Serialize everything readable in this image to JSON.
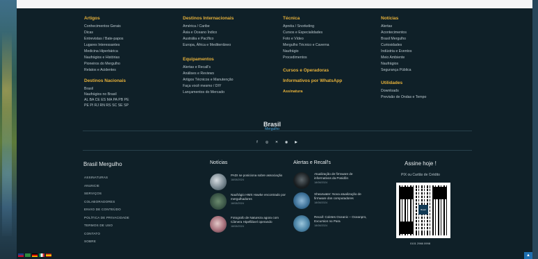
{
  "columns": {
    "artigos": {
      "title": "Artigos",
      "items": [
        "Conhecimentos Gerais",
        "Dicas",
        "Entrevistas / Bate-papos",
        "Lugares Interessantes",
        "Medicina Hiperbárica",
        "Naufrágios e Histórias",
        "Pioneiros do Mergulho",
        "Relatos e Acidentes"
      ]
    },
    "destinos_nacionais": {
      "title": "Destinos Nacionais",
      "items": [
        "Brasil",
        "Naufrágios no Brasil",
        "AL  BA  CE  ES  MA  PA  PB  PE",
        "PE  PI  RJ  RN  RS  SC  SE  SP"
      ]
    },
    "destinos_internacionais": {
      "title": "Destinos Internacionais",
      "items": [
        "América / Caribe",
        "Ásia e Oceano Índico",
        "Austrália e Pacífico",
        "Europa, África e Mediterrâneo"
      ]
    },
    "equipamentos": {
      "title": "Equipamentos",
      "items": [
        "Alertas e Recall's",
        "Análises e Reviews",
        "Artigos Técnicos e Manutenção",
        "Faça você mesmo / DIY",
        "Lançamentos do Mercado"
      ]
    },
    "tecnica": {
      "title": "Técnica",
      "items": [
        "Apnéia / Snorkeling",
        "Cursos e Especialidades",
        "Foto e Vídeo",
        "Mergulho Técnico e Caverna",
        "Naufrágio",
        "Procedimentos"
      ]
    },
    "cursos": {
      "title": "Cursos e Operadoras"
    },
    "whatsapp": {
      "title": "Informativos por WhatsApp"
    },
    "assinatura": {
      "title": "Assinatura"
    },
    "noticias": {
      "title": "Notícias",
      "items": [
        "Alertas",
        "Acontecimentos",
        "Brasil Mergulho",
        "Curiosidades",
        "Indústria e Eventos",
        "Meio Ambiente",
        "Naufrágios",
        "Segurança Pública"
      ]
    },
    "utilidades": {
      "title": "Utilidades",
      "items": [
        "Downloads",
        "Previsão de Ondas e Tempo"
      ]
    }
  },
  "brand": {
    "name": "Brasil",
    "sub": "Mergulho"
  },
  "social_icons": [
    "facebook-icon",
    "instagram-icon",
    "x-icon",
    "whatsapp-icon",
    "youtube-icon"
  ],
  "bottom": {
    "brand_title": "Brasil Mergulho",
    "menu": [
      "ASSINATURAS",
      "ANUNCIE",
      "SERVIÇOS",
      "COLABORADORES",
      "ENVIO DE CONTEÚDO",
      "POLÍTICA DE PRIVACIDADE",
      "TERMOS DE USO",
      "CONTATO",
      "SOBRE"
    ],
    "news_title": "Notícias",
    "news": [
      {
        "title": "PADI se posiciona sobre associação",
        "date": "18/08/2024"
      },
      {
        "title": "Naufrágio HMS Hawke encontrado por mergulhadores",
        "date": "18/08/2024"
      },
      {
        "title": "Fotografo de Natureza agora com Câmera Hipefilável operando",
        "date": "18/08/2024"
      }
    ],
    "alerts_title": "Alertas e Recall's",
    "alerts": [
      {
        "title": "Atualização de firmware de informativos da Posidôn",
        "date": "18/08/2024"
      },
      {
        "title": "Shearwater: Nova atualização de firmware dos computadores",
        "date": "18/08/2024"
      },
      {
        "title": "Recall: Coletes Oceanic – Oceanpro, Excursion no Para",
        "date": "18/08/2024"
      }
    ],
    "subscribe_title": "Assine hoje !",
    "subscribe_sub": "PIX ou Cartão de Crédito",
    "subscribe_code": "0101 2966 0998",
    "qr_logo": "Brasil"
  },
  "colors": {
    "accent": "#e8b23a",
    "background": "#0f2028",
    "link": "#b9c6cc",
    "brand_blue": "#4aa3d8"
  }
}
